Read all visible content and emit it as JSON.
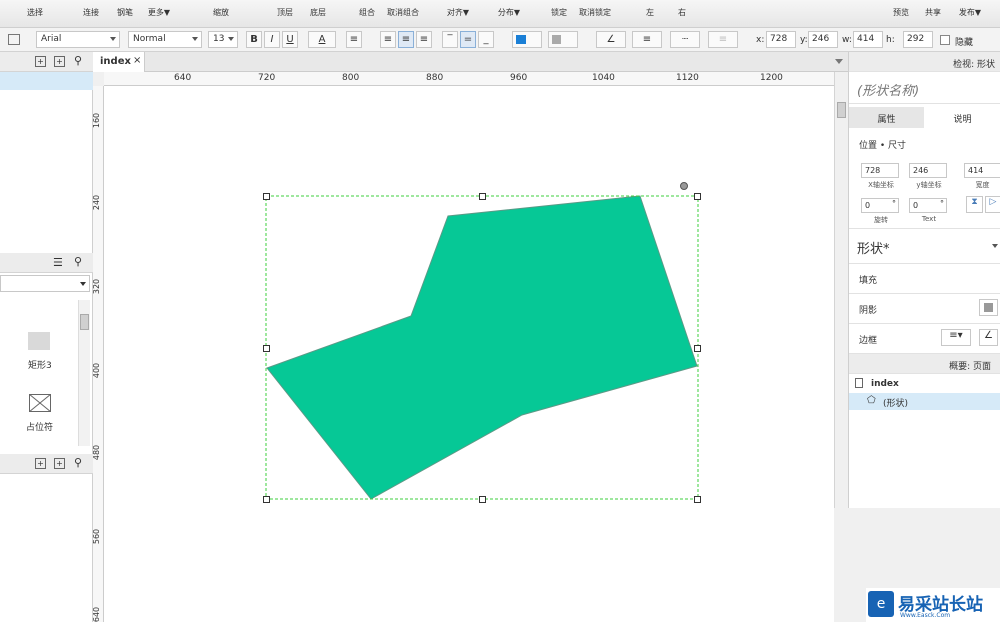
{
  "toolbar": {
    "buttons": [
      "选择",
      "连接",
      "钢笔",
      "更多▼",
      "缩放",
      "顶层",
      "底层",
      "组合",
      "取消组合",
      "对齐▼",
      "分布▼",
      "锁定",
      "取消锁定",
      "左",
      "右",
      "预览",
      "共享",
      "发布▼"
    ]
  },
  "format": {
    "font": "Arial",
    "style": "Normal",
    "size": "13",
    "bold": "B",
    "italic": "I",
    "underline": "U",
    "text_color": "A",
    "x_label": "x:",
    "x_value": "728",
    "y_label": "y:",
    "y_value": "246",
    "w_label": "w:",
    "w_value": "414",
    "h_label": "h:",
    "h_value": "292",
    "hide_label": "隐藏"
  },
  "tab": {
    "label": "index",
    "close": "×"
  },
  "ruler": {
    "h": [
      "640",
      "720",
      "800",
      "880",
      "960",
      "1040",
      "1120",
      "1200"
    ],
    "v": [
      "160",
      "240",
      "320",
      "400",
      "480",
      "560",
      "640"
    ]
  },
  "library": {
    "items": [
      {
        "label": "矩形3",
        "icon": "rectangle-icon"
      },
      {
        "label": "占位符",
        "icon": "placeholder-icon"
      }
    ]
  },
  "inspector": {
    "title": "检视: 形状",
    "shape_name_placeholder": "(形状名称)",
    "tabs": [
      "属性",
      "说明"
    ],
    "section_position": "位置 • 尺寸",
    "x": "728",
    "x_caption": "X轴坐标",
    "y": "246",
    "y_caption": "y轴坐标",
    "w": "414",
    "w_caption": "宽度",
    "rotate": "0",
    "rotate_unit": "°",
    "rotate_caption": "旋转",
    "text_rotate": "0",
    "text_rotate_unit": "°",
    "text_caption": "Text",
    "shape_label": "形状*",
    "fill_label": "填充",
    "shadow_label": "阴影",
    "border_label": "边框"
  },
  "outline": {
    "title": "概要: 页面",
    "page": "index",
    "item": "(形状)"
  },
  "shape": {
    "fill": "#06c896",
    "stroke": "#5a9a86",
    "selection": "#3ccf3c"
  },
  "watermark": {
    "text": "易采站长站",
    "sub": "Www.Easck.Com"
  }
}
